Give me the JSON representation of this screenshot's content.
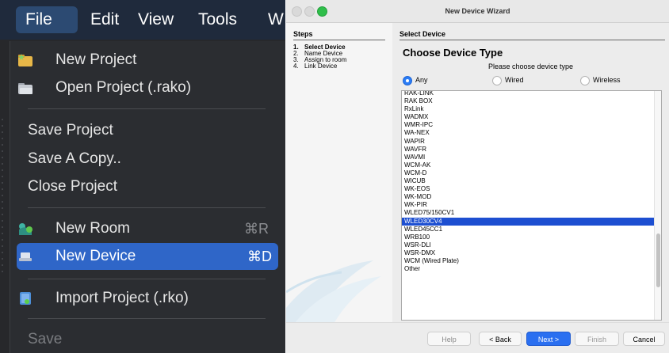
{
  "menubar": {
    "items": [
      "File",
      "Edit",
      "View",
      "Tools",
      "W"
    ]
  },
  "file_menu": {
    "items": [
      {
        "label": "New Project",
        "icon": "new-project-icon"
      },
      {
        "label": "Open Project (.rako)",
        "icon": "folder-icon"
      },
      {
        "label": "Save Project"
      },
      {
        "label": "Save A Copy.."
      },
      {
        "label": "Close Project"
      },
      {
        "label": "New Room",
        "shortcut": "⌘R",
        "icon": "room-icon"
      },
      {
        "label": "New Device",
        "shortcut": "⌘D",
        "icon": "device-icon",
        "selected": true
      },
      {
        "label": "Import Project (.rko)",
        "icon": "import-icon"
      },
      {
        "label": "Save",
        "disabled": true
      }
    ]
  },
  "wizard": {
    "title": "New Device Wizard",
    "steps_title": "Steps",
    "steps": [
      {
        "num": "1.",
        "label": "Select Device",
        "current": true
      },
      {
        "num": "2.",
        "label": "Name Device"
      },
      {
        "num": "3.",
        "label": "Assign to room"
      },
      {
        "num": "4.",
        "label": "Link Device"
      }
    ],
    "section_title": "Select Device",
    "heading": "Choose Device Type",
    "subheading": "Please choose device type",
    "filter_options": [
      {
        "label": "Any",
        "checked": true
      },
      {
        "label": "Wired",
        "checked": false
      },
      {
        "label": "Wireless",
        "checked": false
      }
    ],
    "devices": [
      "RAK-LINK",
      "RAK BOX",
      "RxLink",
      "WADMX",
      "WMR-IPC",
      "WA-NEX",
      "WAPIR",
      "WAVFR",
      "WAVMI",
      "WCM-AK",
      "WCM-D",
      "WICUB",
      "WK-EOS",
      "WK-MOD",
      "WK-PIR",
      "WLED75/150CV1",
      "WLED30CV4",
      "WLED45CC1",
      "WRB100",
      "WSR-DLI",
      "WSR-DMX",
      "WCM (Wired Plate)",
      "Other"
    ],
    "selected_device": "WLED30CV4",
    "buttons": {
      "help": "Help",
      "back": "< Back",
      "next": "Next >",
      "finish": "Finish",
      "cancel": "Cancel"
    },
    "accent_color": "#2a6ff0",
    "selection_color": "#1d4fd1"
  }
}
